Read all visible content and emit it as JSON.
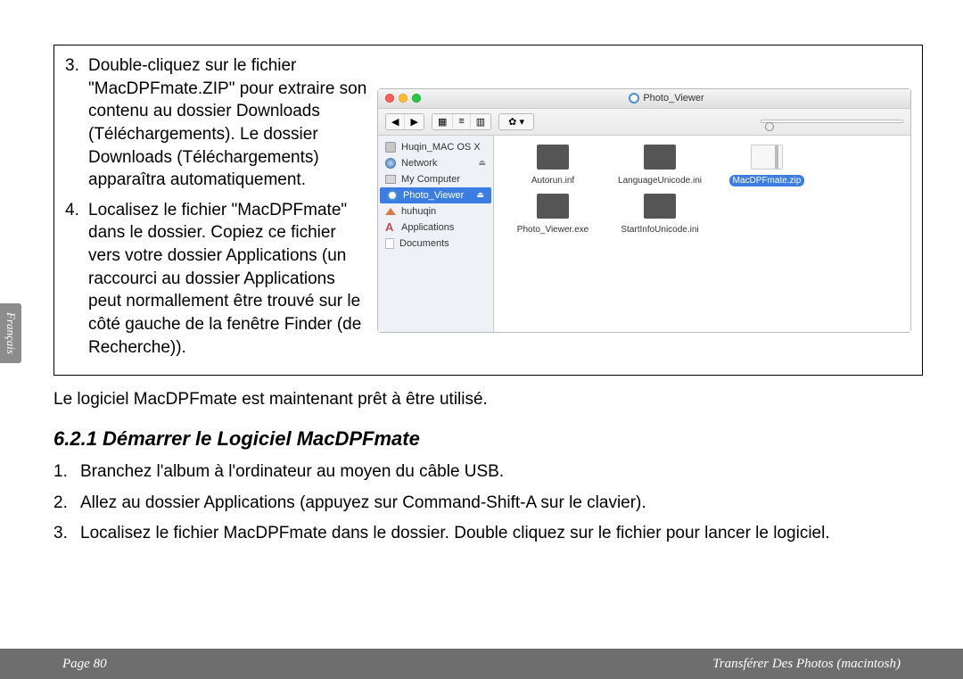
{
  "side_tab": "Français",
  "box_steps": [
    "Double-cliquez sur le fichier \"MacDPFmate.ZIP\" pour extraire son contenu au dossier Downloads (Téléchargements). Le dossier Downloads (Téléchargements) apparaîtra automatiquement.",
    "Localisez le fichier \"MacDPFmate\" dans le dossier. Copiez ce fichier vers votre dossier Applications (un raccourci au dossier Applications peut normallement être trouvé sur le côté gauche de la fenêtre Finder (de Recherche))."
  ],
  "finder": {
    "title": "Photo_Viewer",
    "gear": "✿ ▾",
    "search_placeholder": "",
    "sidebar": [
      {
        "label": "Huqin_MAC OS X",
        "icon": "disk"
      },
      {
        "label": "Network",
        "icon": "globe",
        "eject": true
      },
      {
        "label": "My Computer",
        "icon": "comp"
      },
      {
        "label": "Photo_Viewer",
        "icon": "cd",
        "selected": true,
        "eject": true
      },
      {
        "label": "huhuqin",
        "icon": "home"
      },
      {
        "label": "Applications",
        "icon": "app"
      },
      {
        "label": "Documents",
        "icon": "doc"
      }
    ],
    "files": [
      {
        "label": "Autorun.inf",
        "kind": "dark"
      },
      {
        "label": "LanguageUnicode.ini",
        "kind": "dark"
      },
      {
        "label": "MacDPFmate.zip",
        "kind": "zip",
        "selected": true
      },
      {
        "label": "Photo_Viewer.exe",
        "kind": "dark"
      },
      {
        "label": "StartInfoUnicode.ini",
        "kind": "dark"
      }
    ]
  },
  "below_text": "Le logiciel MacDPFmate est maintenant prêt à être utilisé.",
  "section_heading": "6.2.1    Démarrer le Logiciel MacDPFmate",
  "sub_list": [
    {
      "num": "1.",
      "text": "Branchez l'album à l'ordinateur au moyen du câble USB."
    },
    {
      "num": "2.",
      "text": "Allez au dossier Applications (appuyez sur Command-Shift-A sur le clavier)."
    },
    {
      "num": "3.",
      "text": "Localisez le fichier MacDPFmate dans le dossier. Double cliquez sur le fichier pour lancer le logiciel."
    }
  ],
  "footer": {
    "left": "Page 80",
    "right": "Transférer Des Photos (macintosh)"
  }
}
